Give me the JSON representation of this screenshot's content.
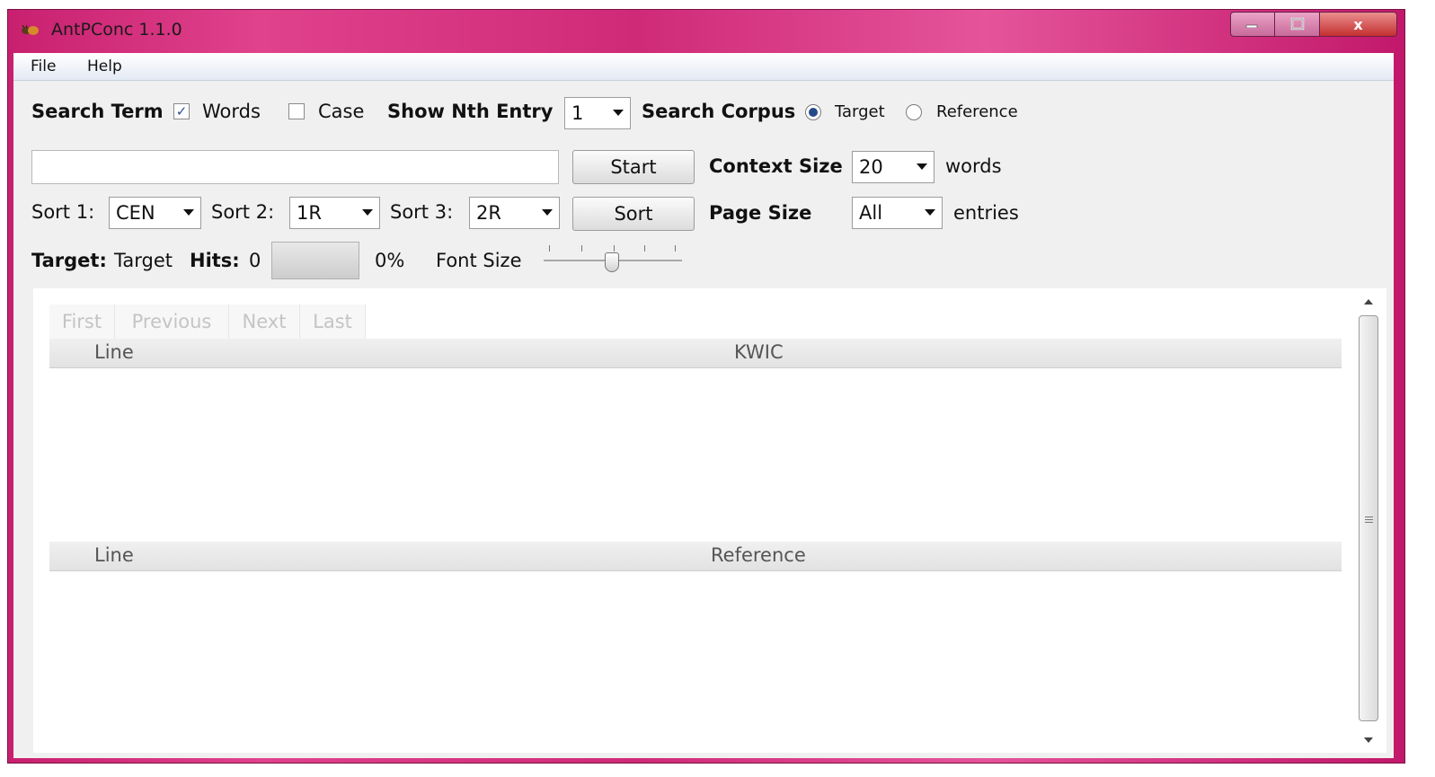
{
  "window": {
    "title": "AntPConc 1.1.0",
    "controls": [
      "minimize-icon",
      "maximize-icon",
      "close-icon"
    ],
    "close_glyph": "x"
  },
  "menu": [
    "File",
    "Help"
  ],
  "search": {
    "label": "Search Term",
    "words": {
      "label": "Words",
      "checked": true
    },
    "case": {
      "label": "Case",
      "checked": false
    },
    "show_nth_label": "Show Nth Entry",
    "show_nth_value": "1",
    "corpus_label": "Search Corpus",
    "corpus_options": [
      {
        "label": "Target",
        "selected": true
      },
      {
        "label": "Reference",
        "selected": false
      }
    ],
    "term_value": "",
    "start_label": "Start",
    "context_label": "Context Size",
    "context_value": "20",
    "context_unit": "words"
  },
  "sort": {
    "sort1_label": "Sort 1:",
    "sort1_value": "CEN",
    "sort2_label": "Sort 2:",
    "sort2_value": "1R",
    "sort3_label": "Sort 3:",
    "sort3_value": "2R",
    "button_label": "Sort",
    "page_size_label": "Page Size",
    "page_size_value": "All",
    "page_size_unit": "entries"
  },
  "status": {
    "target_label": "Target:",
    "target_value": "Target",
    "hits_label": "Hits:",
    "hits_value": "0",
    "progress_percent": "0%",
    "progress_fraction": 0,
    "font_size_label": "Font Size"
  },
  "results": {
    "nav": [
      "First",
      "Previous",
      "Next",
      "Last"
    ],
    "kwic_headers": {
      "line": "Line",
      "main": "KWIC"
    },
    "ref_headers": {
      "line": "Line",
      "main": "Reference"
    }
  }
}
